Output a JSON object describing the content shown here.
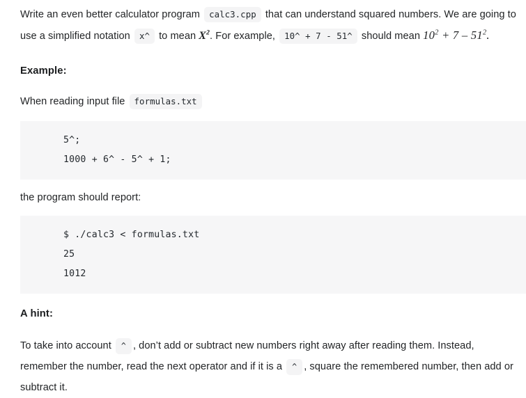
{
  "document": {
    "intro": {
      "seg1": "Write an even better calculator program",
      "code1": "calc3.cpp",
      "seg2": "that can understand squared numbers. We are going to use a simplified notation",
      "code2": "x^",
      "seg3": "to mean",
      "math_var_base": "X",
      "math_var_exp": "2",
      "seg4": ". For example,",
      "code3": "10^ + 7 - 51^",
      "seg5": "should mean",
      "math_expr_a_base": "10",
      "math_expr_a_exp": "2",
      "math_expr_mid": " + 7 – ",
      "math_expr_b_base": "51",
      "math_expr_b_exp": "2",
      "math_expr_end": "."
    },
    "example_heading": "Example:",
    "input_line": {
      "text": "When reading input file",
      "code": "formulas.txt"
    },
    "input_code_block": {
      "lines": [
        "5^;",
        "1000 + 6^ - 5^ + 1;"
      ]
    },
    "report_line": "the program should report:",
    "output_code_block": {
      "lines": [
        "$ ./calc3 < formulas.txt",
        "25",
        "1012"
      ]
    },
    "hint_heading": "A hint:",
    "hint": {
      "seg1": "To take into account",
      "code1": "^",
      "seg2": ", don’t add or subtract new numbers right away after reading them. Instead, remember the number, read the next operator and if it is a",
      "code2": "^",
      "seg3": ", square the remembered number, then add or subtract it."
    },
    "colors": {
      "text": "#222426",
      "code_chip_bg": "#f4f4f5",
      "code_block_bg": "#f6f6f7",
      "page_bg": "#ffffff"
    }
  }
}
